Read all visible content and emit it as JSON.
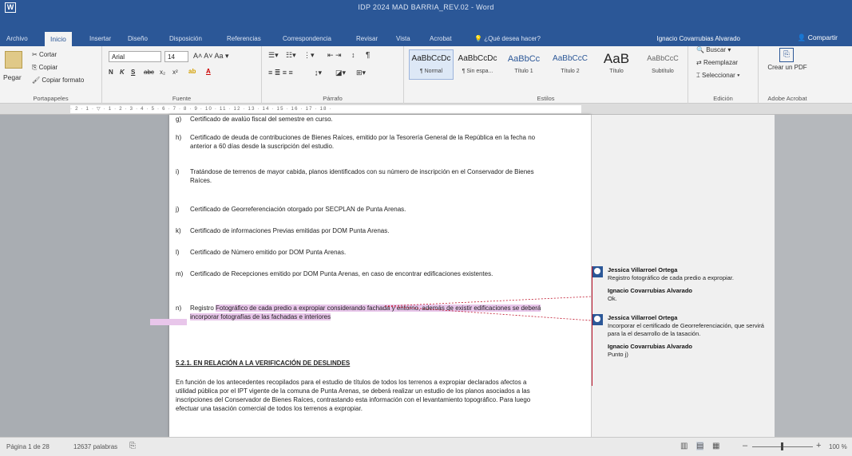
{
  "titlebar": {
    "title": "IDP 2024 MAD BARRIA_REV.02 - Word",
    "app_icon": "W"
  },
  "tabs": [
    {
      "label": "Archivo"
    },
    {
      "label": "Inicio"
    },
    {
      "label": "Insertar"
    },
    {
      "label": "Diseño"
    },
    {
      "label": "Disposición"
    },
    {
      "label": "Referencias"
    },
    {
      "label": "Correspondencia"
    },
    {
      "label": "Revisar"
    },
    {
      "label": "Vista"
    },
    {
      "label": "Acrobat"
    },
    {
      "label": "¿Qué desea hacer?"
    }
  ],
  "account": {
    "user": "Ignacio Covarrubias Alvarado",
    "share": "Compartir"
  },
  "ribbon": {
    "clipboard": {
      "paste": "Pegar",
      "cut": "Cortar",
      "copy": "Copiar",
      "format_painter": "Copiar formato",
      "group": "Portapapeles"
    },
    "font": {
      "name": "Arial",
      "size": "14",
      "group": "Fuente",
      "bold": "N",
      "italic": "K",
      "underline": "S",
      "strike": "abc",
      "sub": "x₂",
      "sup": "x²"
    },
    "paragraph": {
      "group": "Párrafo"
    },
    "styles": {
      "group": "Estilos",
      "items": [
        {
          "preview": "AaBbCcDc",
          "name": "¶ Normal"
        },
        {
          "preview": "AaBbCcDc",
          "name": "¶ Sin espa..."
        },
        {
          "preview": "AaBbCc",
          "name": "Título 1"
        },
        {
          "preview": "AaBbCcC",
          "name": "Título 2"
        },
        {
          "preview": "AaB",
          "name": "Título"
        },
        {
          "preview": "AaBbCcC",
          "name": "Subtítulo"
        }
      ]
    },
    "editing": {
      "group": "Edición",
      "find": "Buscar",
      "replace": "Reemplazar",
      "select": "Seleccionar"
    },
    "acrobat": {
      "group": "Adobe Acrobat",
      "create": "Crear un PDF"
    }
  },
  "document": {
    "items": [
      {
        "letter": "g)",
        "text": "Certificado de avalúo fiscal del semestre en curso."
      },
      {
        "letter": "h)",
        "text": "Certificado de deuda de contribuciones de Bienes Raíces, emitido por la Tesorería General de la República en la fecha no anterior a 60 días desde la suscripción del estudio."
      },
      {
        "letter": "i)",
        "text": "Tratándose de terrenos de mayor cabida, planos identificados con su número de inscripción en el Conservador de Bienes Raíces."
      },
      {
        "letter": "j)",
        "text": "Certificado de Georreferenciación otorgado por SECPLAN de Punta Arenas."
      },
      {
        "letter": "k)",
        "text": "Certificado de informaciones Previas emitidas por DOM Punta Arenas."
      },
      {
        "letter": "l)",
        "text": "Certificado de Número emitido por DOM Punta Arenas."
      },
      {
        "letter": "m)",
        "text": "Certificado de Recepciones emitido por DOM Punta Arenas, en caso de encontrar edificaciones existentes."
      },
      {
        "letter": "n)",
        "text_before": "Registro ",
        "text_highlight": "Fotográfico de cada predio a expropiar considerando fachada y entorno, además de existir edificaciones se deberá incorporar fotografías de las fachadas e interiores"
      }
    ],
    "section_heading": "5.2.1.  EN RELACIÓN A LA VERIFICACIÓN DE DESLINDES",
    "section_paragraph": "En función de los antecedentes recopilados para el estudio de títulos de todos los terrenos a expropiar declarados afectos a utilidad pública por el IPT vigente de la comuna de Punta Arenas, se deberá realizar un estudio de los planos asociados a las inscripciones del Conservador de Bienes Raíces, contrastando esta información con el levantamiento topográfico. Para luego efectuar una tasación comercial de todos los terrenos a expropiar."
  },
  "comments": [
    {
      "author": "Jessica Villarroel Ortega",
      "text": "Registro fotográfico de cada predio a expropiar.",
      "reply_author": "Ignacio Covarrubias Alvarado",
      "reply_text": "Ok."
    },
    {
      "author": "Jessica Villarroel Ortega",
      "text": "Incorporar el certificado de Georreferenciación, que servirá para la el desarrollo de la tasación.",
      "reply_author": "Ignacio Covarrubias Alvarado",
      "reply_text": "Punto j)"
    }
  ],
  "statusbar": {
    "page": "Página 1 de 28",
    "words": "12637 palabras",
    "zoom": "100 %"
  },
  "colors": {
    "accent": "#2b5797",
    "highlight": "#e8c6ea",
    "comment_line": "#c0182e"
  }
}
